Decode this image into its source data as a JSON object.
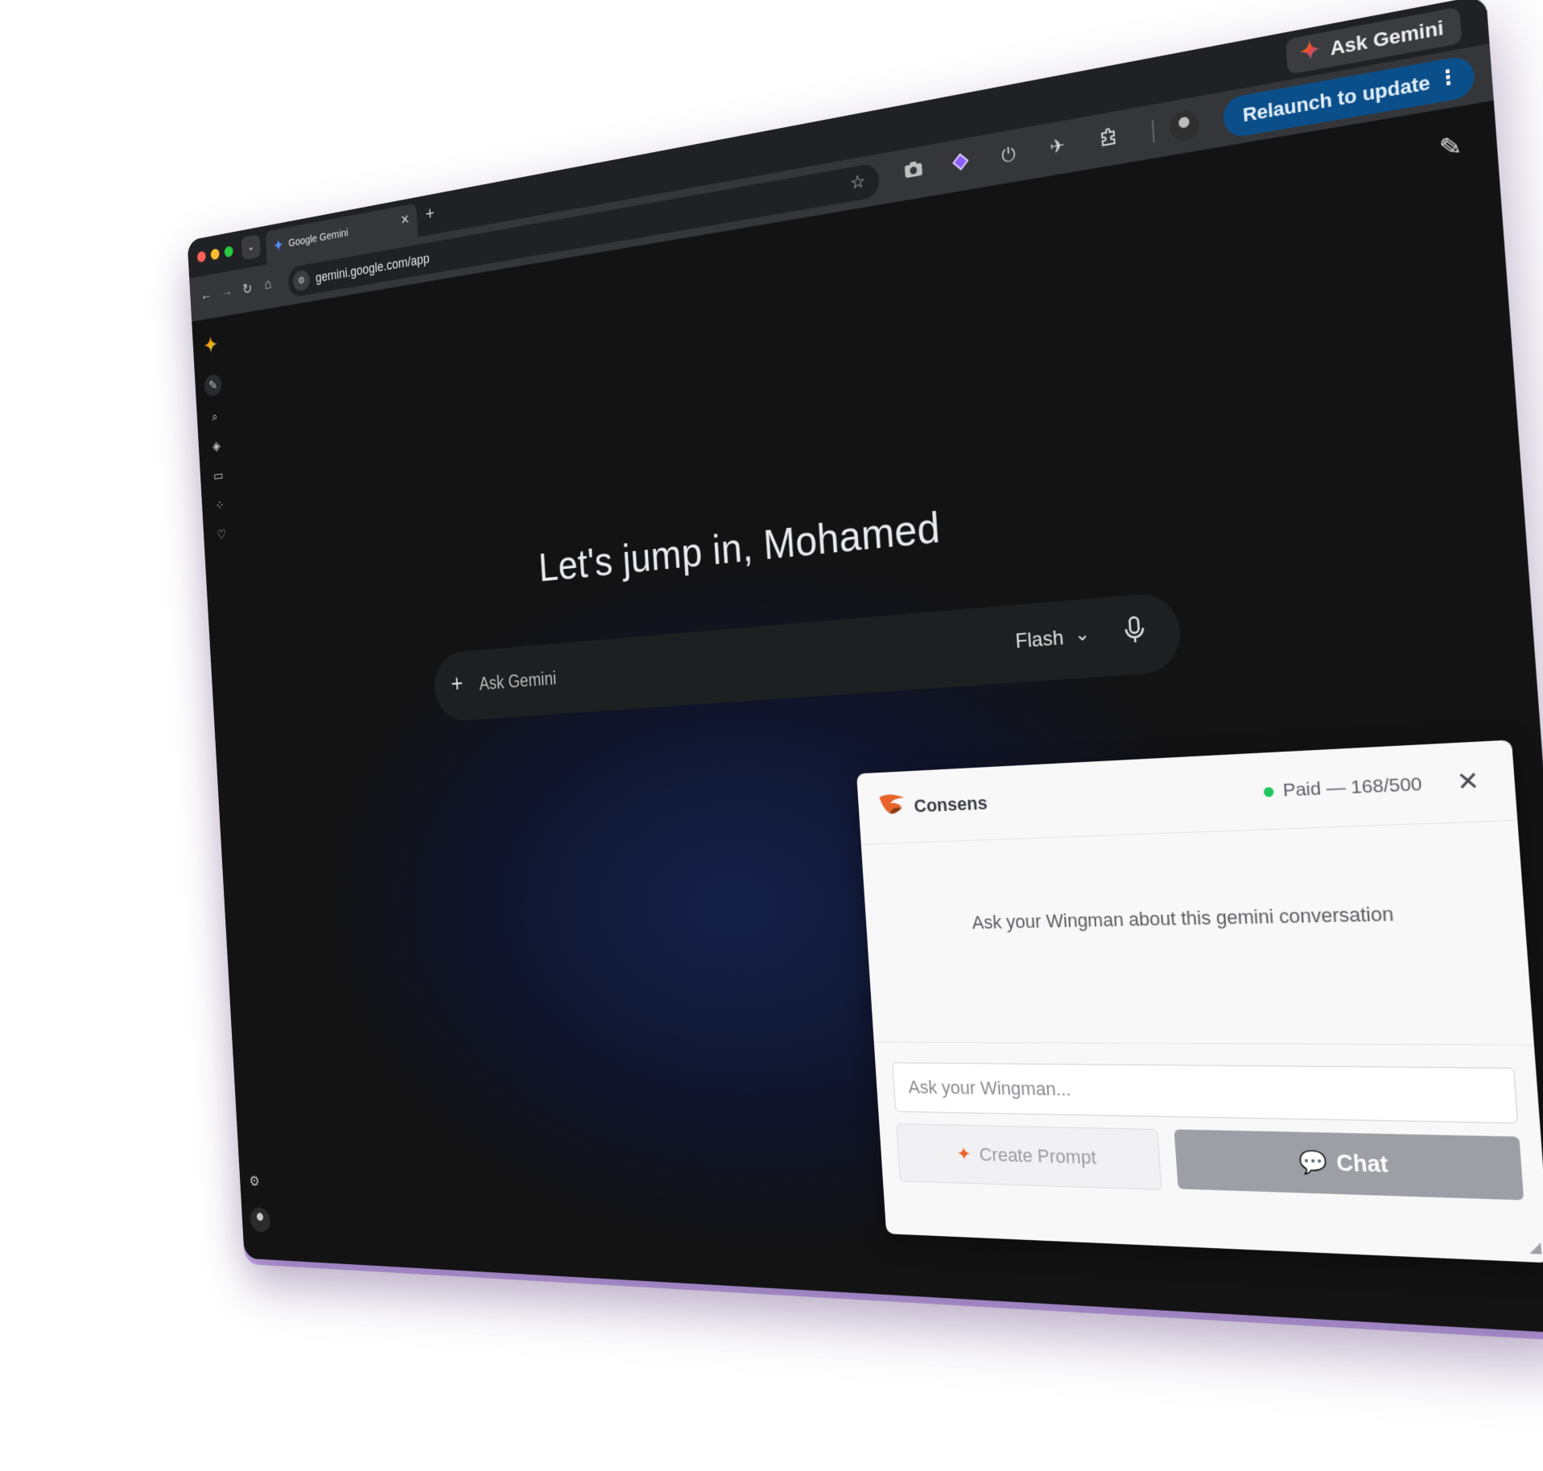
{
  "tab": {
    "title": "Google Gemini"
  },
  "browser": {
    "url": "gemini.google.com/app",
    "ask_gemini": "Ask Gemini",
    "relaunch_label": "Relaunch to update"
  },
  "page": {
    "greeting": "Let's jump in, Mohamed",
    "prompt_placeholder": "Ask Gemini",
    "model_label": "Flash"
  },
  "consens": {
    "brand": "Consens",
    "plan_status": "Paid — 168/500",
    "empty_message": "Ask your Wingman about this gemini conversation",
    "input_placeholder": "Ask your Wingman...",
    "create_prompt_label": "Create Prompt",
    "chat_label": "Chat"
  },
  "colors": {
    "relaunch_bg": "#0b4f8a",
    "status_dot": "#22c55e",
    "consens_brand": "#e8632a"
  }
}
